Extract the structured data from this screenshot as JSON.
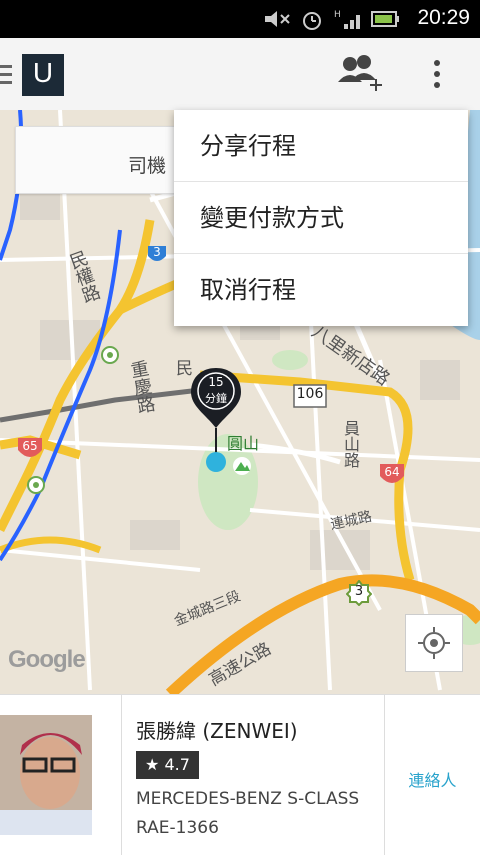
{
  "status_bar": {
    "time": "20:29"
  },
  "action_bar": {
    "logo_letter": "U"
  },
  "overflow_menu": {
    "items": [
      "分享行程",
      "變更付款方式",
      "取消行程"
    ]
  },
  "map": {
    "driver_box_label": "司機",
    "eta": {
      "value": "15",
      "unit": "分鐘"
    },
    "labels": {
      "minquan_road": "民權路",
      "chongqing_road": "重慶路",
      "yuanshan": "圓山",
      "shanhu_road": "員山路",
      "lianhe_road": "連城路",
      "jincheng_road": "金城路三段",
      "xinhai_road": "八里新店路",
      "freeway": "高速公路",
      "route_106": "106",
      "route_64": "64",
      "route_65": "65",
      "route_3a": "3",
      "route_3b": "3",
      "min_fragment": "民"
    },
    "attribution": "Google"
  },
  "driver": {
    "name": "張勝緯 (ZENWEI)",
    "rating": "4.7",
    "car": "MERCEDES-BENZ S-CLASS",
    "plate": "RAE-1366",
    "contact_label": "連絡人"
  }
}
